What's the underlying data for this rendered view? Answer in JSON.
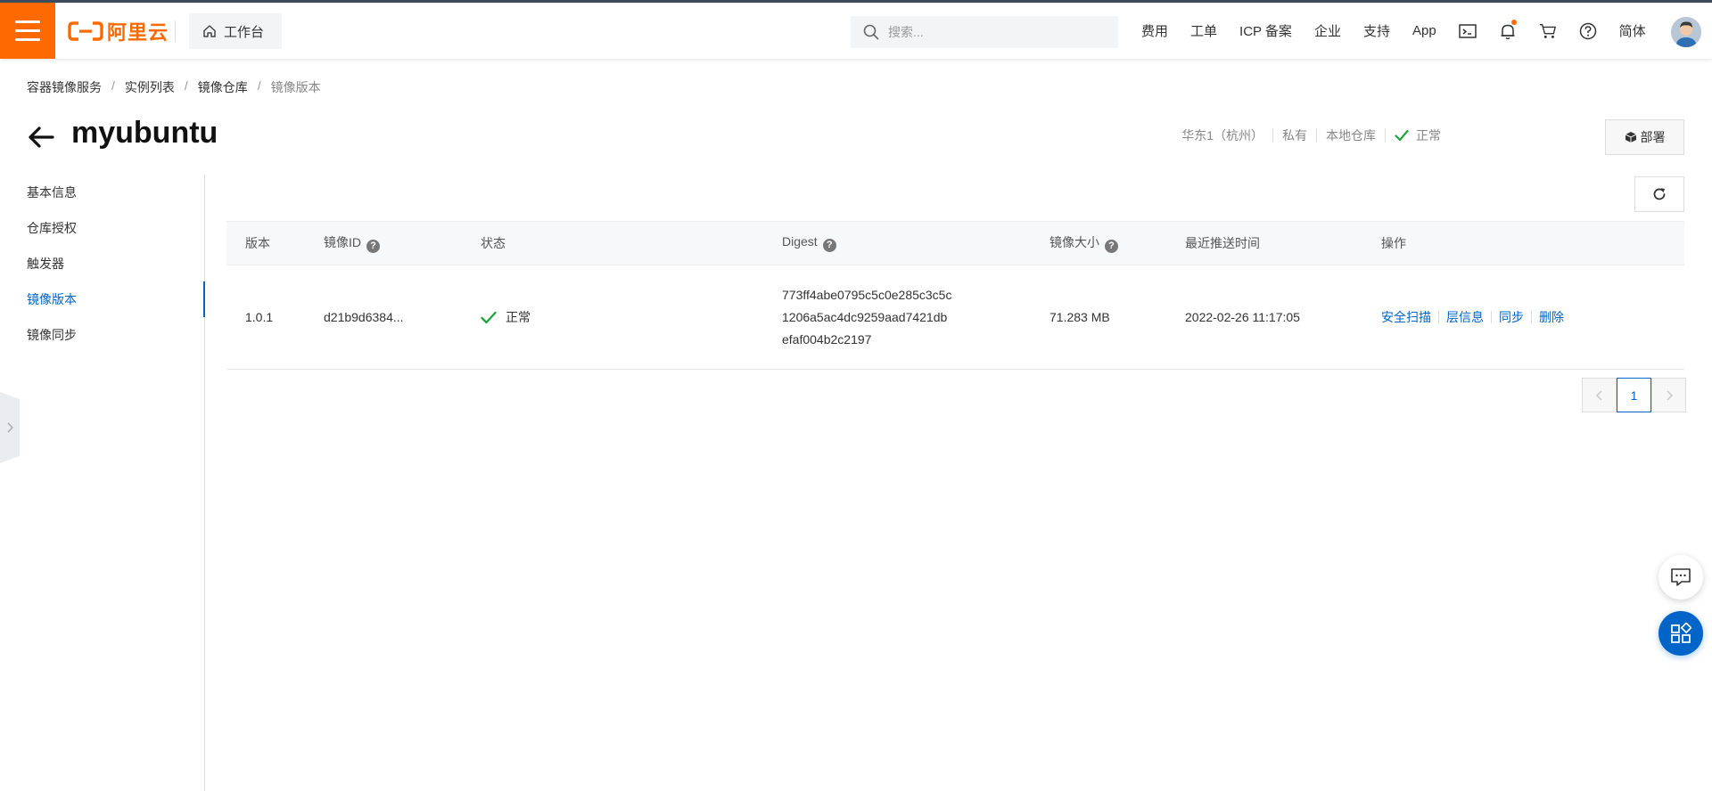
{
  "topbar": {
    "logo_text": "阿里云",
    "workbench_label": "工作台",
    "search_placeholder": "搜索...",
    "nav_links": [
      "费用",
      "工单",
      "ICP 备案",
      "企业",
      "支持",
      "App"
    ],
    "language_label": "简体",
    "accent_color": "#ff6a00"
  },
  "breadcrumb": [
    "容器镜像服务",
    "实例列表",
    "镜像仓库",
    "镜像版本"
  ],
  "header": {
    "title": "myubuntu",
    "region": "华东1（杭州）",
    "visibility": "私有",
    "repo_type": "本地仓库",
    "status": "正常",
    "deploy_label": "部署"
  },
  "sidebar": {
    "items": [
      {
        "label": "基本信息",
        "active": false
      },
      {
        "label": "仓库授权",
        "active": false
      },
      {
        "label": "触发器",
        "active": false
      },
      {
        "label": "镜像版本",
        "active": true
      },
      {
        "label": "镜像同步",
        "active": false
      }
    ]
  },
  "table": {
    "columns": [
      "版本",
      "镜像ID",
      "状态",
      "Digest",
      "镜像大小",
      "最近推送时间",
      "操作"
    ],
    "rows": [
      {
        "version": "1.0.1",
        "image_id": "d21b9d6384...",
        "status": "正常",
        "digest_lines": [
          "773ff4abe0795c5c0e285c3c5c",
          "1206a5ac4dc9259aad7421db",
          "efaf004b2c2197"
        ],
        "size": "71.283 MB",
        "pushed_at": "2022-02-26 11:17:05",
        "actions": [
          "安全扫描",
          "层信息",
          "同步",
          "删除"
        ]
      }
    ]
  },
  "pagination": {
    "current_page": "1"
  },
  "colors": {
    "link": "#0064c8",
    "success": "#1ea53b"
  }
}
